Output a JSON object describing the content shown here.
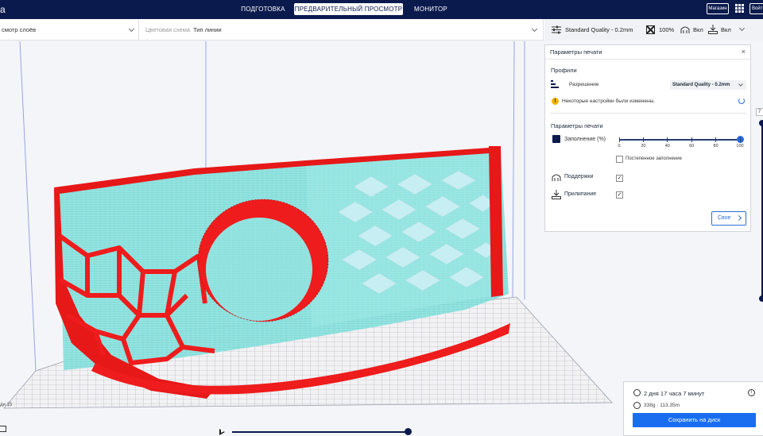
{
  "app": {
    "logo_fragment": "a"
  },
  "stages": {
    "prepare": "ПОДГОТОВКА",
    "preview": "ПРЕДВАРИТЕЛЬНЫЙ ПРОСМОТР",
    "monitor": "МОНИТОР"
  },
  "topbar": {
    "marketplace": "Магазин",
    "signin": "Войт"
  },
  "view_mode": {
    "value": "смотр слоёв"
  },
  "color_scheme": {
    "label": "Цветовая схема",
    "value": "Тип линии"
  },
  "print_summary": {
    "profile": "Standard Quality - 0.2mm",
    "infill": "100%",
    "support": "Вкл",
    "adhesion": "Вкл"
  },
  "settings_panel": {
    "title": "Параметры печати",
    "profiles_heading": "Профили",
    "resolution_label": "Разрешение",
    "resolution_value": "Standard Quality - 0.2mm",
    "warning": "Некоторые настройки были изменены.",
    "print_params_heading": "Параметры печати",
    "infill_label": "Заполнение (%)",
    "infill_value": 100,
    "infill_ticks": [
      "0",
      "20",
      "40",
      "60",
      "80",
      "100"
    ],
    "gradual_infill_label": "Постепенное заполнение",
    "gradual_infill_checked": false,
    "support_label": "Поддержки",
    "support_checked": true,
    "adhesion_label": "Прилипание",
    "adhesion_checked": true,
    "custom_button": "Свое"
  },
  "layer_slider": {
    "top_value": "7"
  },
  "bottom": {
    "layer_label": "ди 15"
  },
  "output": {
    "print_time": "2 дня 17 часа 7 минут",
    "material": "338g · 113.35m",
    "save_button": "Сохранить на диск"
  },
  "colors": {
    "topbar": "#0b1a4d",
    "infill": "#7fe0dc",
    "wall": "#ee1c1c",
    "accent": "#196ef0"
  }
}
